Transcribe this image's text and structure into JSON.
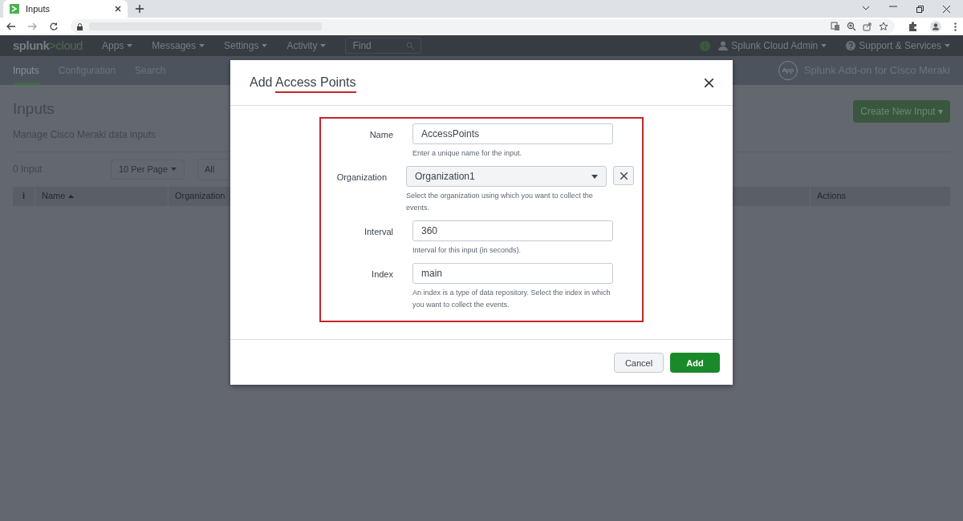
{
  "browser": {
    "tab_title": "Inputs"
  },
  "splunk_bar": {
    "logo_brand": "splunk",
    "logo_product": ">cloud",
    "menus": [
      "Apps",
      "Messages",
      "Settings",
      "Activity"
    ],
    "find_placeholder": "Find",
    "user": "Splunk Cloud Admin",
    "support": "Support & Services"
  },
  "app_bar": {
    "tabs": [
      {
        "label": "Inputs",
        "selected": true
      },
      {
        "label": "Configuration",
        "selected": false
      },
      {
        "label": "Search",
        "selected": false
      }
    ],
    "app_badge": "App",
    "app_name": "Splunk Add-on for Cisco Meraki"
  },
  "page": {
    "title": "Inputs",
    "description": "Manage Cisco Meraki data inputs",
    "create_button": "Create New Input ▾",
    "count": "0 Input",
    "per_page": "10 Per Page",
    "filter": "All",
    "columns": [
      "i",
      "Name",
      "Organization",
      "Actions"
    ]
  },
  "dialog": {
    "title_prefix": "Add",
    "title_highlight": "Access Points",
    "fields": [
      {
        "kind": "text",
        "label": "Name",
        "value": "AccessPoints",
        "help": "Enter a unique name for the input."
      },
      {
        "kind": "select",
        "label": "Organization",
        "value": "Organization1",
        "help": "Select the organization using which you want to collect the events.",
        "clearable": true
      },
      {
        "kind": "text",
        "label": "Interval",
        "value": "360",
        "help": "Interval for this input (in seconds)."
      },
      {
        "kind": "text",
        "label": "Index",
        "value": "main",
        "help": "An index is a type of data repository. Select the index in which you want to collect the events."
      }
    ],
    "buttons": [
      {
        "kind": "secondary",
        "label": "Cancel"
      },
      {
        "kind": "primary",
        "label": "Add"
      }
    ]
  }
}
